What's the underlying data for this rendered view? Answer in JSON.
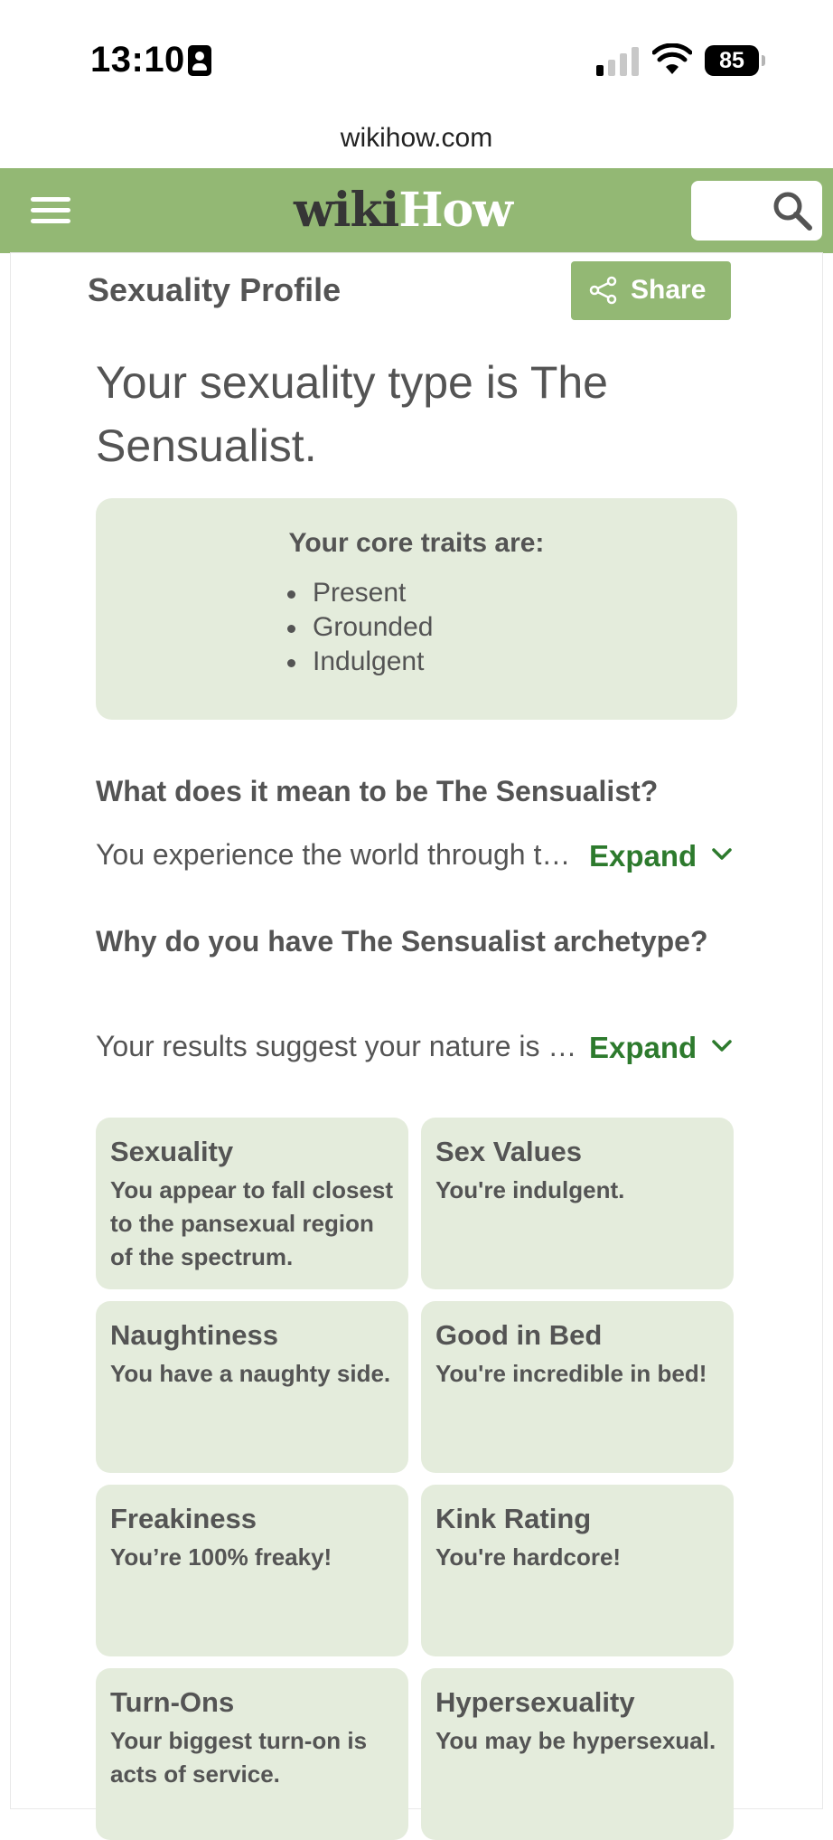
{
  "status_bar": {
    "time": "13:10",
    "battery": "85"
  },
  "browser": {
    "url": "wikihow.com"
  },
  "nav": {
    "logo_wiki": "wiki",
    "logo_how": "How"
  },
  "header": {
    "title": "Sexuality Profile",
    "share_label": "Share"
  },
  "result": {
    "title": "Your sexuality type is The Sensualist."
  },
  "traits": {
    "heading": "Your core traits are:",
    "items": [
      "Present",
      "Grounded",
      "Indulgent"
    ]
  },
  "sections": [
    {
      "heading": "What does it mean to be The Sensualist?",
      "preview": "You experience the world through the senses and love to savor every moment.",
      "expand_label": "Expand"
    },
    {
      "heading": "Why do you have The Sensualist archetype?",
      "preview": "Your results suggest your nature is deeply rooted in the physical and present.",
      "expand_label": "Expand"
    }
  ],
  "cards": [
    {
      "title": "Sexuality",
      "text": "You appear to fall closest to the pansexual region of the spectrum."
    },
    {
      "title": "Sex Values",
      "text": "You're indulgent."
    },
    {
      "title": "Naughtiness",
      "text": "You have a naughty side."
    },
    {
      "title": "Good in Bed",
      "text": "You're incredible in bed!"
    },
    {
      "title": "Freakiness",
      "text": "You’re 100% freaky!"
    },
    {
      "title": "Kink Rating",
      "text": "You're hardcore!"
    },
    {
      "title": "Turn-Ons",
      "text": "Your biggest turn-on is acts of service."
    },
    {
      "title": "Hypersexuality",
      "text": "You may be hypersexual."
    }
  ],
  "colors": {
    "brand_green": "#93b874",
    "card_bg": "#e4ecdc",
    "link_green": "#2d7a2d",
    "text": "#545454"
  }
}
